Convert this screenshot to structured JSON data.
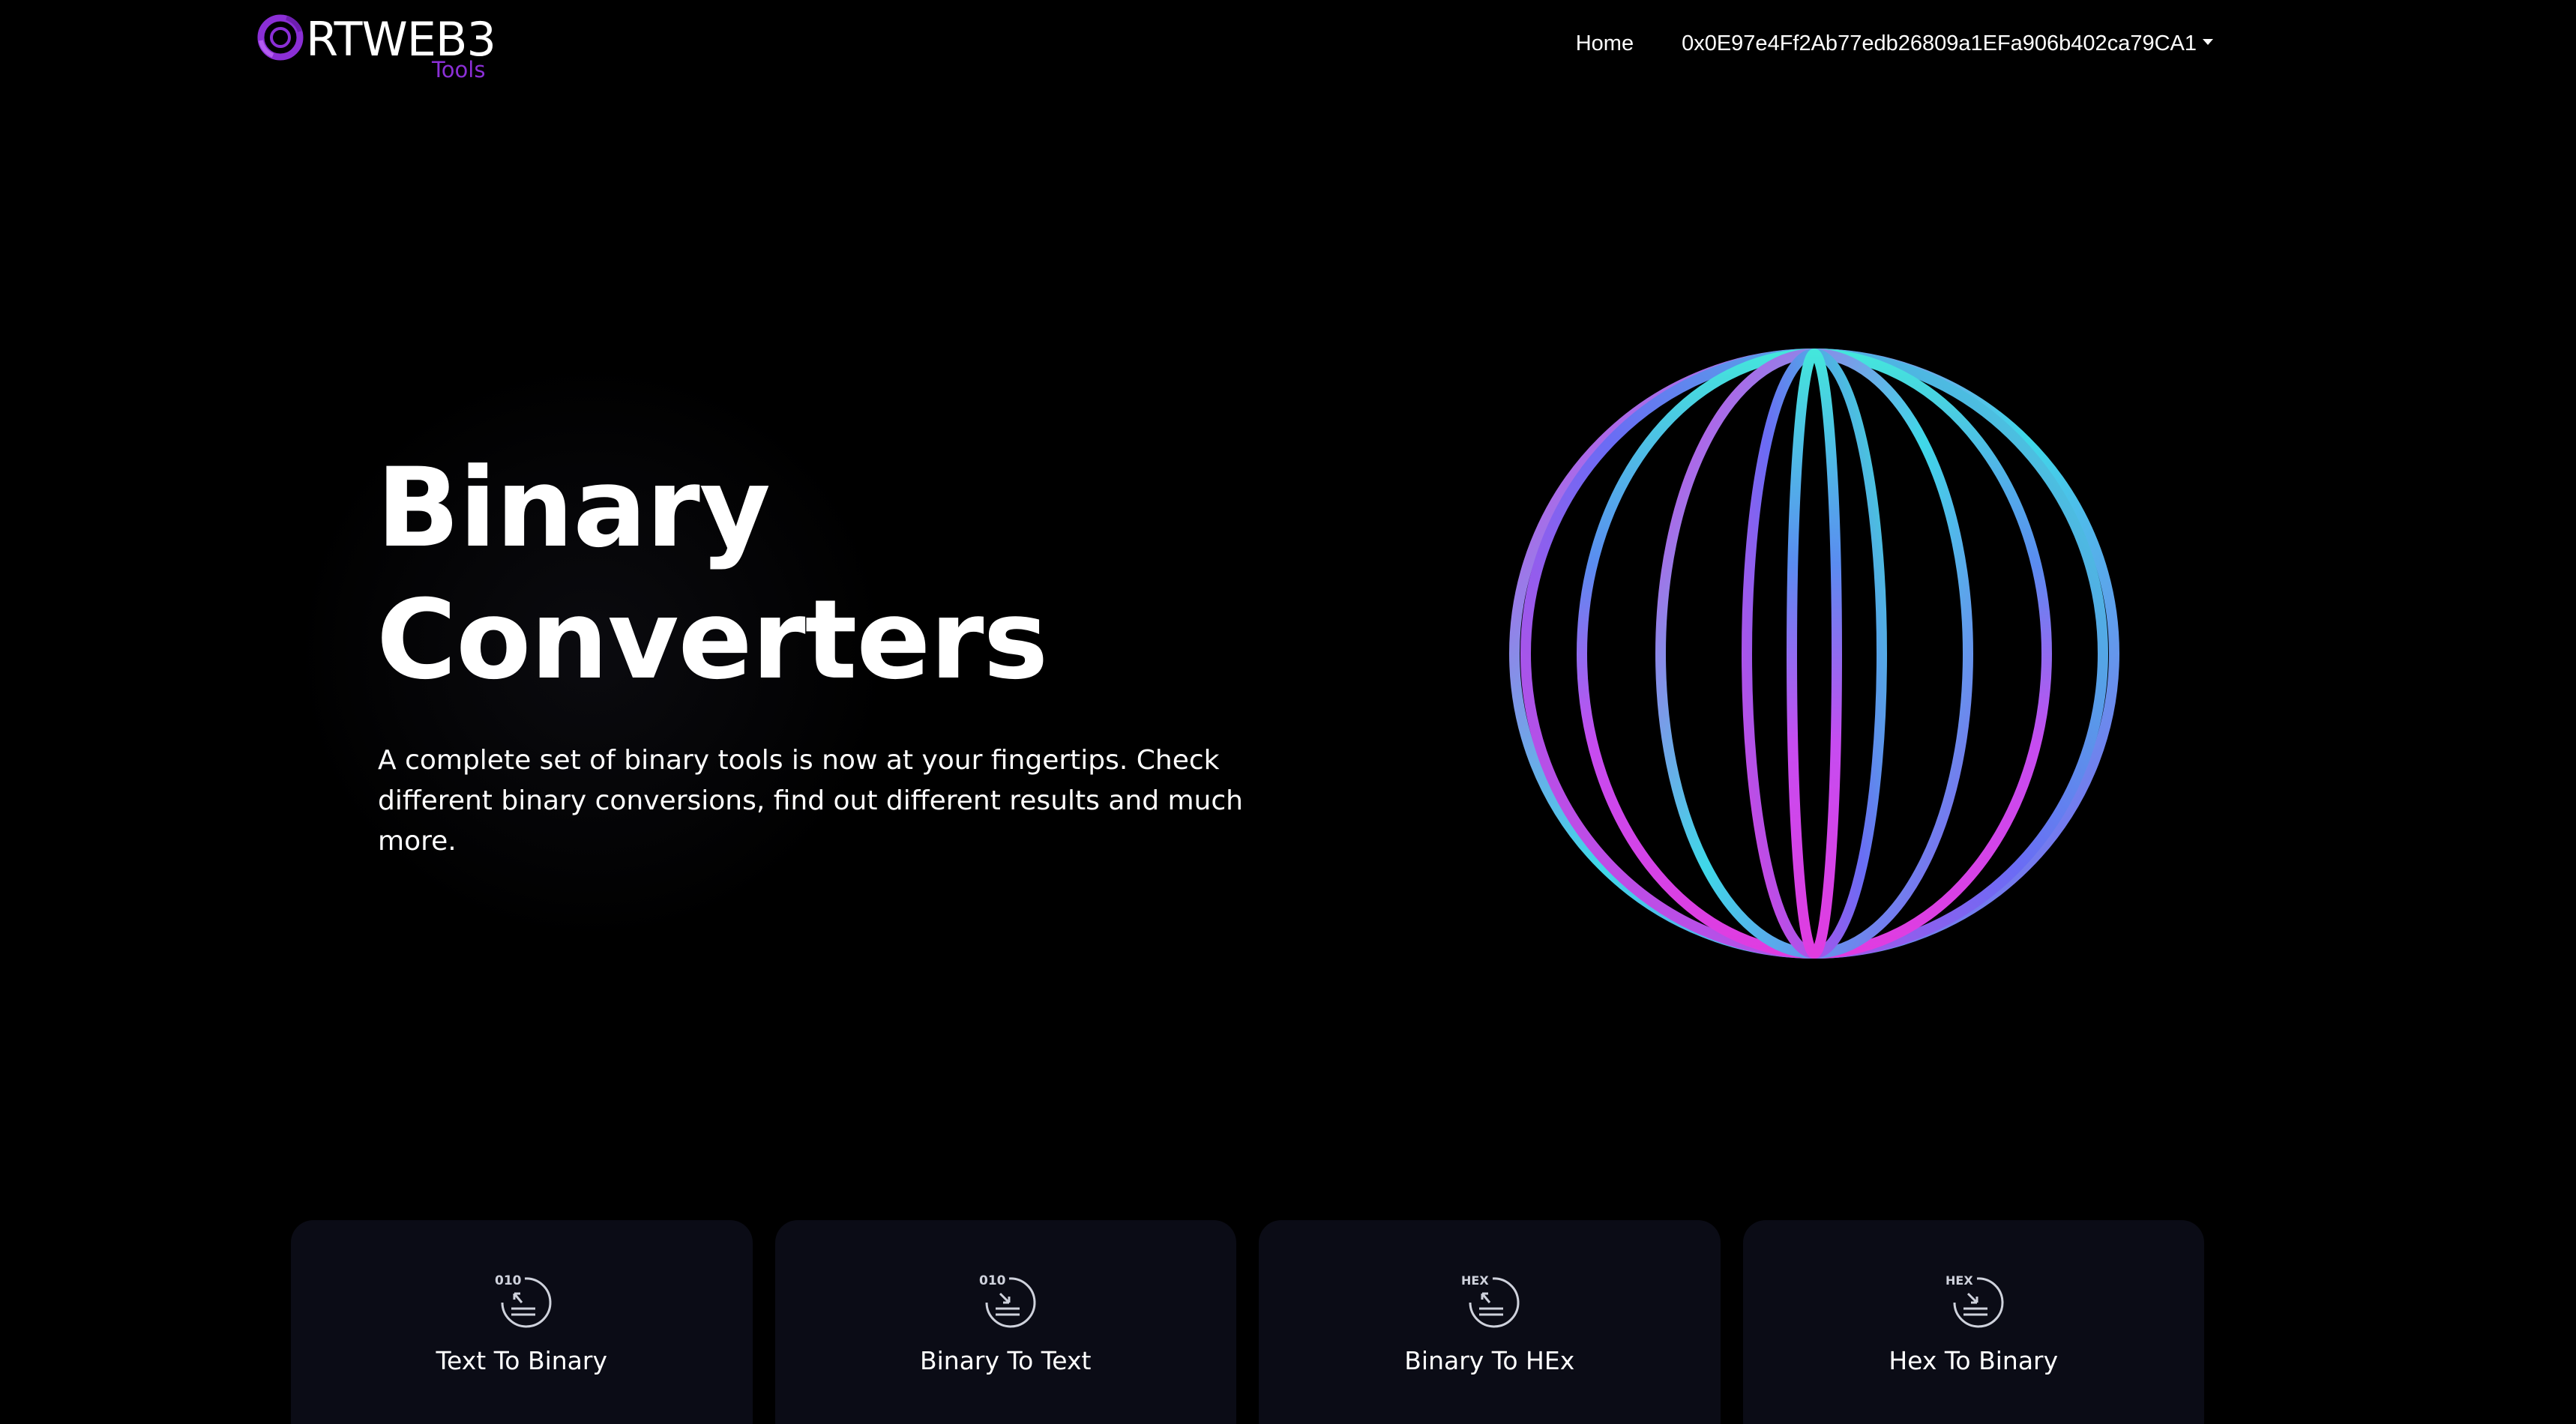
{
  "brand": {
    "name": "RTWEB3",
    "sub": "Tools",
    "accent": "#8b2fd6"
  },
  "nav": {
    "home": "Home",
    "wallet": "0x0E97e4Ff2Ab77edb26809a1EFa906b402ca79CA1"
  },
  "hero": {
    "title_line1": "Binary",
    "title_line2": "Converters",
    "description": "A complete set of binary tools is now at your fingertips. Check different binary conversions, find out different results and much more."
  },
  "cards": [
    {
      "label": "Text To Binary",
      "icon_text": "010",
      "icon": "text-to-binary-icon"
    },
    {
      "label": "Binary To Text",
      "icon_text": "010",
      "icon": "binary-to-text-icon"
    },
    {
      "label": "Binary To HEx",
      "icon_text": "HEX",
      "icon": "binary-to-hex-icon"
    },
    {
      "label": "Hex To Binary",
      "icon_text": "HEX",
      "icon": "hex-to-binary-icon"
    }
  ],
  "colors": {
    "background": "#000000",
    "card": "#0b0c16",
    "sphere_cyan": "#3fe0e0",
    "sphere_magenta": "#d43ce8",
    "sphere_blue": "#5a6cf0"
  }
}
